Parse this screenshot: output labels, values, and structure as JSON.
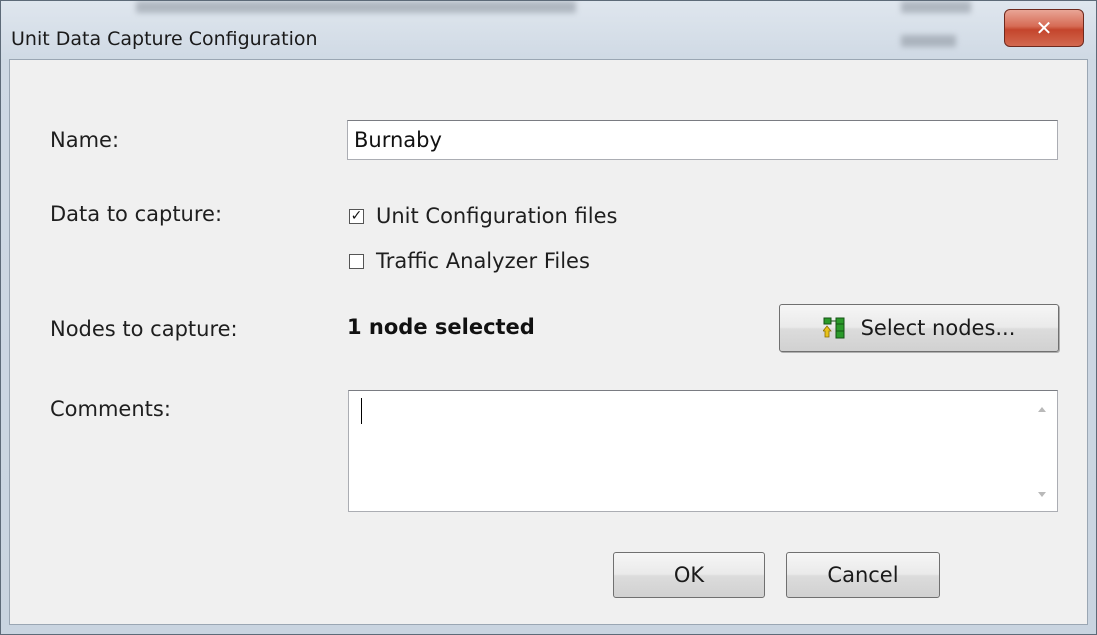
{
  "window": {
    "title": "Unit Data Capture Configuration",
    "close_glyph": "✕"
  },
  "form": {
    "name_label": "Name:",
    "name_value": "Burnaby",
    "data_label": "Data to capture:",
    "options": [
      {
        "label": "Unit Configuration files",
        "checked": true
      },
      {
        "label": "Traffic Analyzer Files",
        "checked": false
      }
    ],
    "nodes_label": "Nodes to capture:",
    "nodes_value": "1 node selected",
    "select_nodes_label": "Select nodes...",
    "select_nodes_icon": "tree-nodes-icon",
    "comments_label": "Comments:",
    "comments_value": ""
  },
  "buttons": {
    "ok": "OK",
    "cancel": "Cancel"
  },
  "checkmark_glyph": "✓",
  "colors": {
    "close_button": "#c4452c",
    "icon_green": "#2a9a2a",
    "icon_yellow": "#e8c21a"
  }
}
